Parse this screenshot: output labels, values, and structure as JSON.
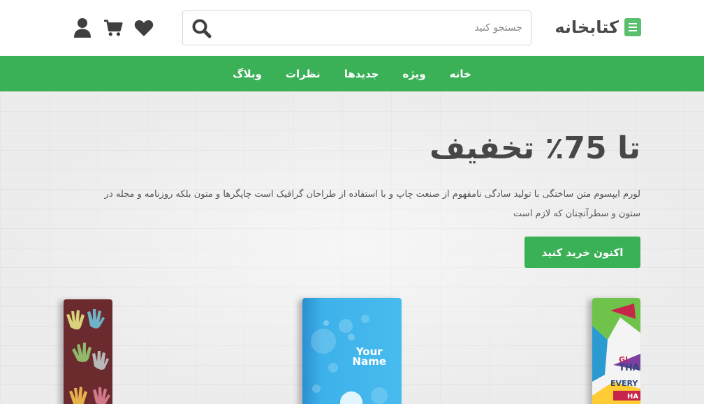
{
  "header": {
    "logo_text": "کتابخانه",
    "search_placeholder": "جستجو کنید",
    "search_value": ""
  },
  "icons": {
    "logo": "book-icon",
    "search": "search-icon",
    "wishlist": "heart-icon",
    "cart": "cart-icon",
    "account": "user-icon"
  },
  "nav": {
    "items": [
      {
        "label": "خانه"
      },
      {
        "label": "ویژه"
      },
      {
        "label": "جدیدها"
      },
      {
        "label": "نظرات"
      },
      {
        "label": "وبلاگ"
      }
    ]
  },
  "hero": {
    "title": "تا 75٪ تخفیف",
    "description": "لورم ایپسوم متن ساختگی با تولید سادگی نامفهوم از صنعت چاپ و با استفاده از طراحان گرافیک است چاپگرها و متون بلکه روزنامه و مجله در ستون و سطرآنچنان که لازم است",
    "button_label": "اکنون خرید کنید"
  },
  "books": [
    {
      "name": "hands-pattern-book"
    },
    {
      "name": "blue-bubbles-book",
      "cover_text_1": "Your",
      "cover_text_2": "Name"
    },
    {
      "name": "thank-everyone-book",
      "cover_lines": [
        "GI",
        "THA",
        "EVERY",
        "HA"
      ]
    }
  ],
  "colors": {
    "brand_green": "#3ab057",
    "logo_green": "#5cbf6e",
    "icon_dark": "#3f3f3f",
    "text_dark": "#474747"
  }
}
